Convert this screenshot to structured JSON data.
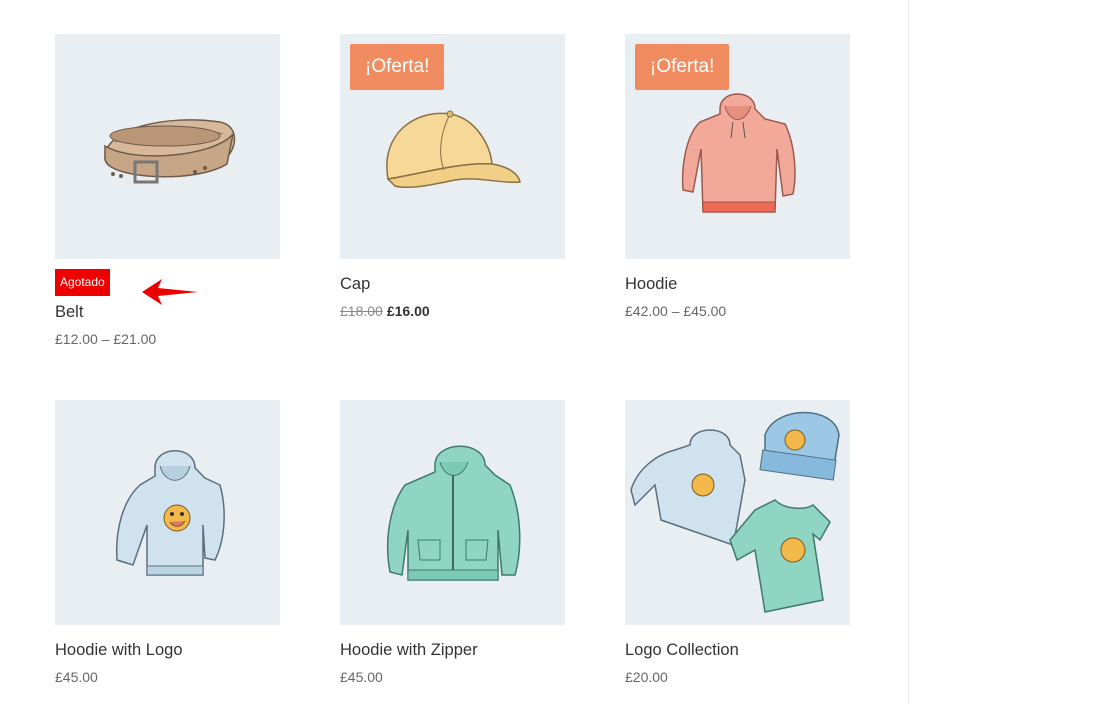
{
  "products": [
    {
      "name": "Belt",
      "price": "£12.00 – £21.00",
      "stock_badge": "Agotado",
      "image": "belt-illustration"
    },
    {
      "name": "Cap",
      "sale_badge": "¡Oferta!",
      "old_price": "£18.00",
      "new_price": "£16.00",
      "image": "cap-illustration"
    },
    {
      "name": "Hoodie",
      "sale_badge": "¡Oferta!",
      "price": "£42.00 – £45.00",
      "image": "hoodie-illustration"
    },
    {
      "name": "Hoodie with Logo",
      "price": "£45.00",
      "image": "hoodie-with-logo-illustration"
    },
    {
      "name": "Hoodie with Zipper",
      "price": "£45.00",
      "image": "hoodie-with-zipper-illustration"
    },
    {
      "name": "Logo Collection",
      "price": "£20.00",
      "image": "logo-collection-illustration"
    }
  ],
  "colors": {
    "thumb_background": "#e9eef2",
    "sale_badge": "#f08c5f",
    "stock_badge": "#ee0000",
    "annotation_arrow": "#ee0000"
  },
  "annotation": {
    "icon": "red-arrow-icon"
  }
}
